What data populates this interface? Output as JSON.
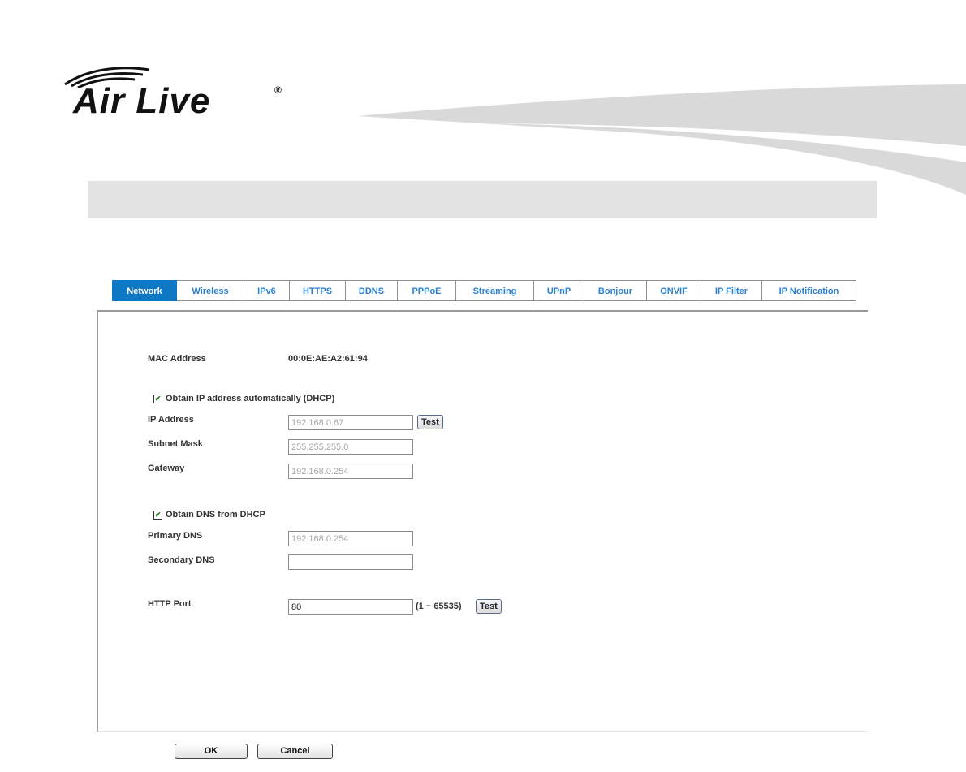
{
  "brand": {
    "logo_text": "Air Live",
    "registered": "®"
  },
  "tabs": [
    {
      "label": "Network",
      "active": true
    },
    {
      "label": "Wireless"
    },
    {
      "label": "IPv6"
    },
    {
      "label": "HTTPS"
    },
    {
      "label": "DDNS"
    },
    {
      "label": "PPPoE"
    },
    {
      "label": "Streaming"
    },
    {
      "label": "UPnP"
    },
    {
      "label": "Bonjour"
    },
    {
      "label": "ONVIF"
    },
    {
      "label": "IP Filter"
    },
    {
      "label": "IP Notification"
    }
  ],
  "form": {
    "mac_label": "MAC Address",
    "mac_value": "00:0E:AE:A2:61:94",
    "dhcp_label": "Obtain IP address automatically (DHCP)",
    "dhcp_checked": true,
    "ip_label": "IP Address",
    "ip_value": "192.168.0.67",
    "subnet_label": "Subnet Mask",
    "subnet_value": "255.255.255.0",
    "gateway_label": "Gateway",
    "gateway_value": "192.168.0.254",
    "dns_dhcp_label": "Obtain DNS from DHCP",
    "dns_dhcp_checked": true,
    "primary_dns_label": "Primary DNS",
    "primary_dns_value": "192.168.0.254",
    "secondary_dns_label": "Secondary DNS",
    "secondary_dns_value": "",
    "http_port_label": "HTTP Port",
    "http_port_value": "80",
    "http_port_range": "(1 ~ 65535)",
    "test_label": "Test"
  },
  "footer": {
    "ok_label": "OK",
    "cancel_label": "Cancel"
  },
  "colors": {
    "accent": "#0e78c5",
    "tab_text": "#2b7fd0",
    "header_bar": "#e3e3e3"
  }
}
